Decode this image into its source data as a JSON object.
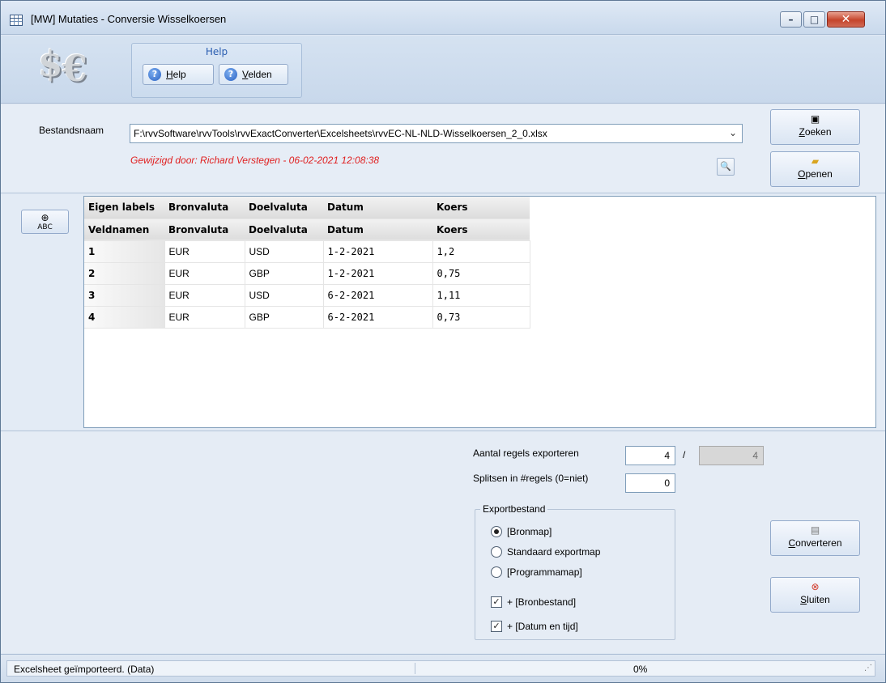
{
  "window": {
    "title": "[MW]  Mutaties - Conversie Wisselkoersen",
    "min_glyph": "–",
    "max_glyph": "□",
    "close_glyph": "✕"
  },
  "logo": {
    "dollar": "$",
    "euro": "€"
  },
  "help_group": {
    "caption": "Help",
    "help_label": "Help",
    "velden_label": "Velden"
  },
  "file": {
    "label": "Bestandsnaam",
    "path": "F:\\rvvSoftware\\rvvTools\\rvvExactConverter\\Excelsheets\\rvvEC-NL-NLD-Wisselkoersen_2_0.xlsx",
    "modified_text": "Gewijzigd door: Richard Verstegen   -   06-02-2021  12:08:38",
    "zoeken_label": "Zoeken",
    "openen_label": "Openen"
  },
  "grid": {
    "side_button_label": "ABC",
    "header_rows": [
      [
        "Eigen labels",
        "Bronvaluta",
        "Doelvaluta",
        "Datum",
        "Koers"
      ],
      [
        "Veldnamen",
        "Bronvaluta",
        "Doelvaluta",
        "Datum",
        "Koers"
      ]
    ],
    "rows": [
      [
        "1",
        "EUR",
        "USD",
        "1-2-2021",
        "1,2"
      ],
      [
        "2",
        "EUR",
        "GBP",
        "1-2-2021",
        "0,75"
      ],
      [
        "3",
        "EUR",
        "USD",
        "6-2-2021",
        "1,11"
      ],
      [
        "4",
        "EUR",
        "GBP",
        "6-2-2021",
        "0,73"
      ]
    ]
  },
  "export": {
    "aantal_label": "Aantal regels exporteren",
    "aantal_value": "4",
    "slash": "/",
    "total_value": "4",
    "splitsen_label": "Splitsen in #regels (0=niet)",
    "splitsen_value": "0",
    "group_caption": "Exportbestand",
    "options": [
      {
        "label": "[Bronmap]",
        "selected": true
      },
      {
        "label": "Standaard exportmap",
        "selected": false
      },
      {
        "label": "[Programmamap]",
        "selected": false
      }
    ],
    "checks": [
      {
        "label": "+ [Bronbestand]",
        "checked": true
      },
      {
        "label": "+ [Datum en tijd]",
        "checked": true
      }
    ],
    "converteren_label": "Converteren",
    "sluiten_label": "Sluiten"
  },
  "status": {
    "message": "Excelsheet geïmporteerd. (Data)",
    "progress": "0%"
  }
}
